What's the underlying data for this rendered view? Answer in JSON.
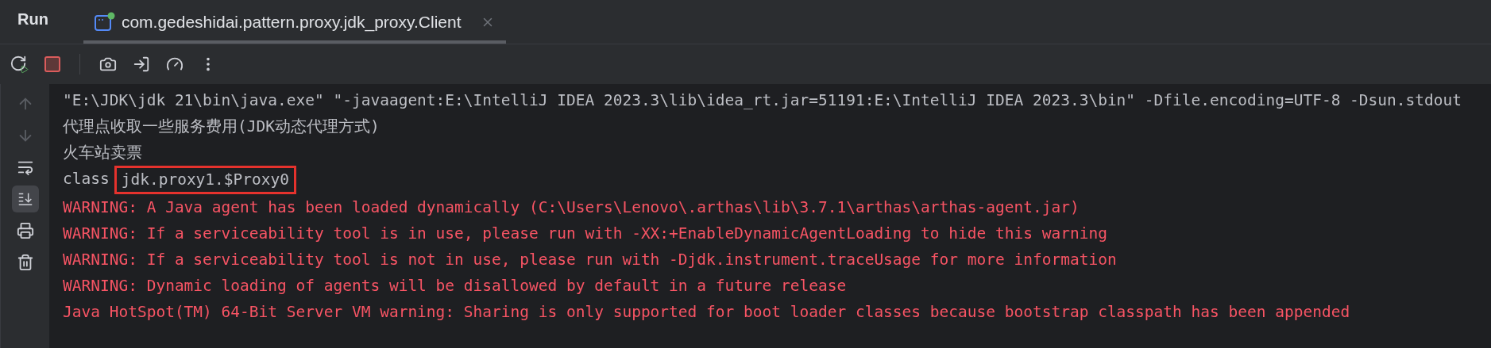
{
  "tool_window": {
    "title": "Run"
  },
  "tabs": [
    {
      "label": "com.gedeshidai.pattern.proxy.jdk_proxy.Client",
      "selected": true,
      "running": true
    }
  ],
  "toolbar": [
    {
      "kind": "rerun"
    },
    {
      "kind": "stop"
    },
    {
      "kind": "divider"
    },
    {
      "kind": "camera"
    },
    {
      "kind": "exit"
    },
    {
      "kind": "gauge"
    },
    {
      "kind": "more"
    }
  ],
  "gutter": [
    {
      "kind": "up",
      "disabled": true,
      "selected": false
    },
    {
      "kind": "down",
      "disabled": true,
      "selected": false
    },
    {
      "kind": "wrap",
      "disabled": false,
      "selected": false
    },
    {
      "kind": "scroll-end",
      "disabled": false,
      "selected": true
    },
    {
      "kind": "print",
      "disabled": false,
      "selected": false
    },
    {
      "kind": "trash",
      "disabled": false,
      "selected": false
    }
  ],
  "console": [
    {
      "kind": "info",
      "text": "\"E:\\JDK\\jdk 21\\bin\\java.exe\" \"-javaagent:E:\\IntelliJ IDEA 2023.3\\lib\\idea_rt.jar=51191:E:\\IntelliJ IDEA 2023.3\\bin\" -Dfile.encoding=UTF-8 -Dsun.stdout"
    },
    {
      "kind": "info",
      "text": "代理点收取一些服务费用(JDK动态代理方式)"
    },
    {
      "kind": "info",
      "text": "火车站卖票"
    },
    {
      "kind": "info",
      "text": "class",
      "boxed": "jdk.proxy1.$Proxy0"
    },
    {
      "kind": "error",
      "text": "WARNING: A Java agent has been loaded dynamically (C:\\Users\\Lenovo\\.arthas\\lib\\3.7.1\\arthas\\arthas-agent.jar)"
    },
    {
      "kind": "error",
      "text": "WARNING: If a serviceability tool is in use, please run with -XX:+EnableDynamicAgentLoading to hide this warning"
    },
    {
      "kind": "error",
      "text": "WARNING: If a serviceability tool is not in use, please run with -Djdk.instrument.traceUsage for more information"
    },
    {
      "kind": "error",
      "text": "WARNING: Dynamic loading of agents will be disallowed by default in a future release"
    },
    {
      "kind": "error",
      "text": "Java HotSpot(TM) 64-Bit Server VM warning: Sharing is only supported for boot loader classes because bootstrap classpath has been appended"
    }
  ]
}
